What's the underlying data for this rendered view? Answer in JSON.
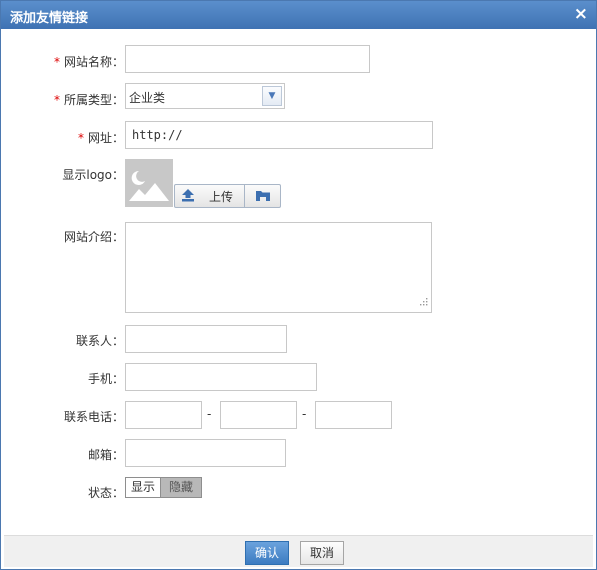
{
  "dialog": {
    "title": "添加友情链接",
    "close": "×"
  },
  "form": {
    "required_mark": "*",
    "name": {
      "label": "网站名称：",
      "value": "",
      "placeholder": ""
    },
    "category": {
      "label": "所属类型：",
      "value": "企业类"
    },
    "url": {
      "label": "网址：",
      "value": "http://"
    },
    "logo": {
      "label": "显示logo：",
      "upload": "上传"
    },
    "intro": {
      "label": "网站介绍：",
      "value": ""
    },
    "contact": {
      "label": "联系人：",
      "value": ""
    },
    "mobile": {
      "label": "手机：",
      "value": ""
    },
    "phone": {
      "label": "联系电话：",
      "sep": "-"
    },
    "email": {
      "label": "邮箱：",
      "value": ""
    },
    "status": {
      "label": "状态：",
      "on": "显示",
      "off": "隐藏"
    }
  },
  "footer": {
    "confirm": "确认",
    "cancel": "取消"
  },
  "colors": {
    "title_bar": "#4a7ec0",
    "required": "#dd0000",
    "primary_button": "#3d7cc1"
  },
  "icons": {
    "close": "close-icon",
    "dropdown": "chevron-down-icon",
    "upload": "upload-icon",
    "pick": "folder-icon",
    "logo_placeholder": "image-placeholder-icon",
    "resize": "resize-grip-icon"
  }
}
